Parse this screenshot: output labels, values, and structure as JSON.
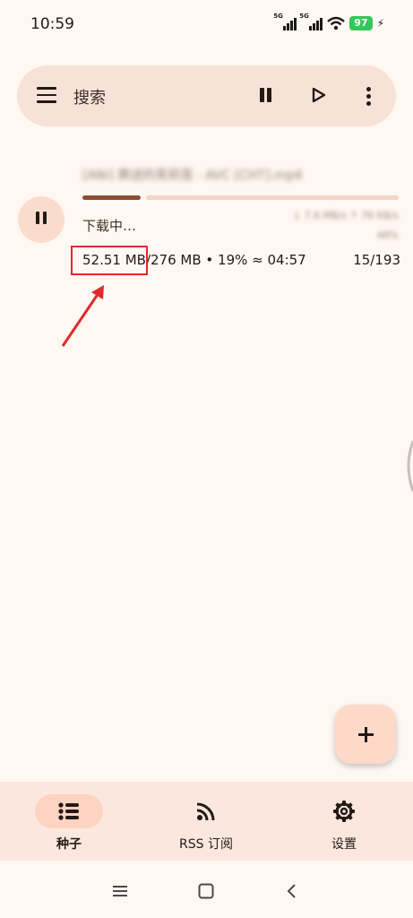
{
  "status_bar": {
    "time": "10:59",
    "signal_1": "5G",
    "signal_2": "5G",
    "battery": "97"
  },
  "search_bar": {
    "placeholder": "搜索",
    "icons": [
      "menu-icon",
      "pause-icon",
      "play-icon",
      "more-vert-icon"
    ]
  },
  "torrent": {
    "name": "[ANi] 葬送的芙莉莲 - AVC [CHT].mp4",
    "status": "下载中…",
    "meta_line1": "↓ 7.6 MB/s ↑ 76 KB/s",
    "meta_line2": "48%",
    "downloaded": "52.51 MB",
    "total": "/276 MB",
    "separator": " • ",
    "percent": "19%",
    "eta": " ≈ 04:57",
    "pieces": "15/193",
    "progress_fraction": 0.19
  },
  "annotation": {
    "box_color": "#e02a2a",
    "arrow_color": "#e02a2a"
  },
  "fab": {
    "icon": "plus-icon"
  },
  "bottom_nav": {
    "items": [
      {
        "label": "种子",
        "icon": "list-icon",
        "active": true
      },
      {
        "label": "RSS 订阅",
        "icon": "rss-icon",
        "active": false
      },
      {
        "label": "设置",
        "icon": "gear-icon",
        "active": false
      }
    ]
  },
  "colors": {
    "background": "#fff7f2",
    "search_bar": "#f7e2d8",
    "accent": "#8a4f34",
    "accent_container": "#fbdccc",
    "nav_bar": "#fbe7dd"
  }
}
